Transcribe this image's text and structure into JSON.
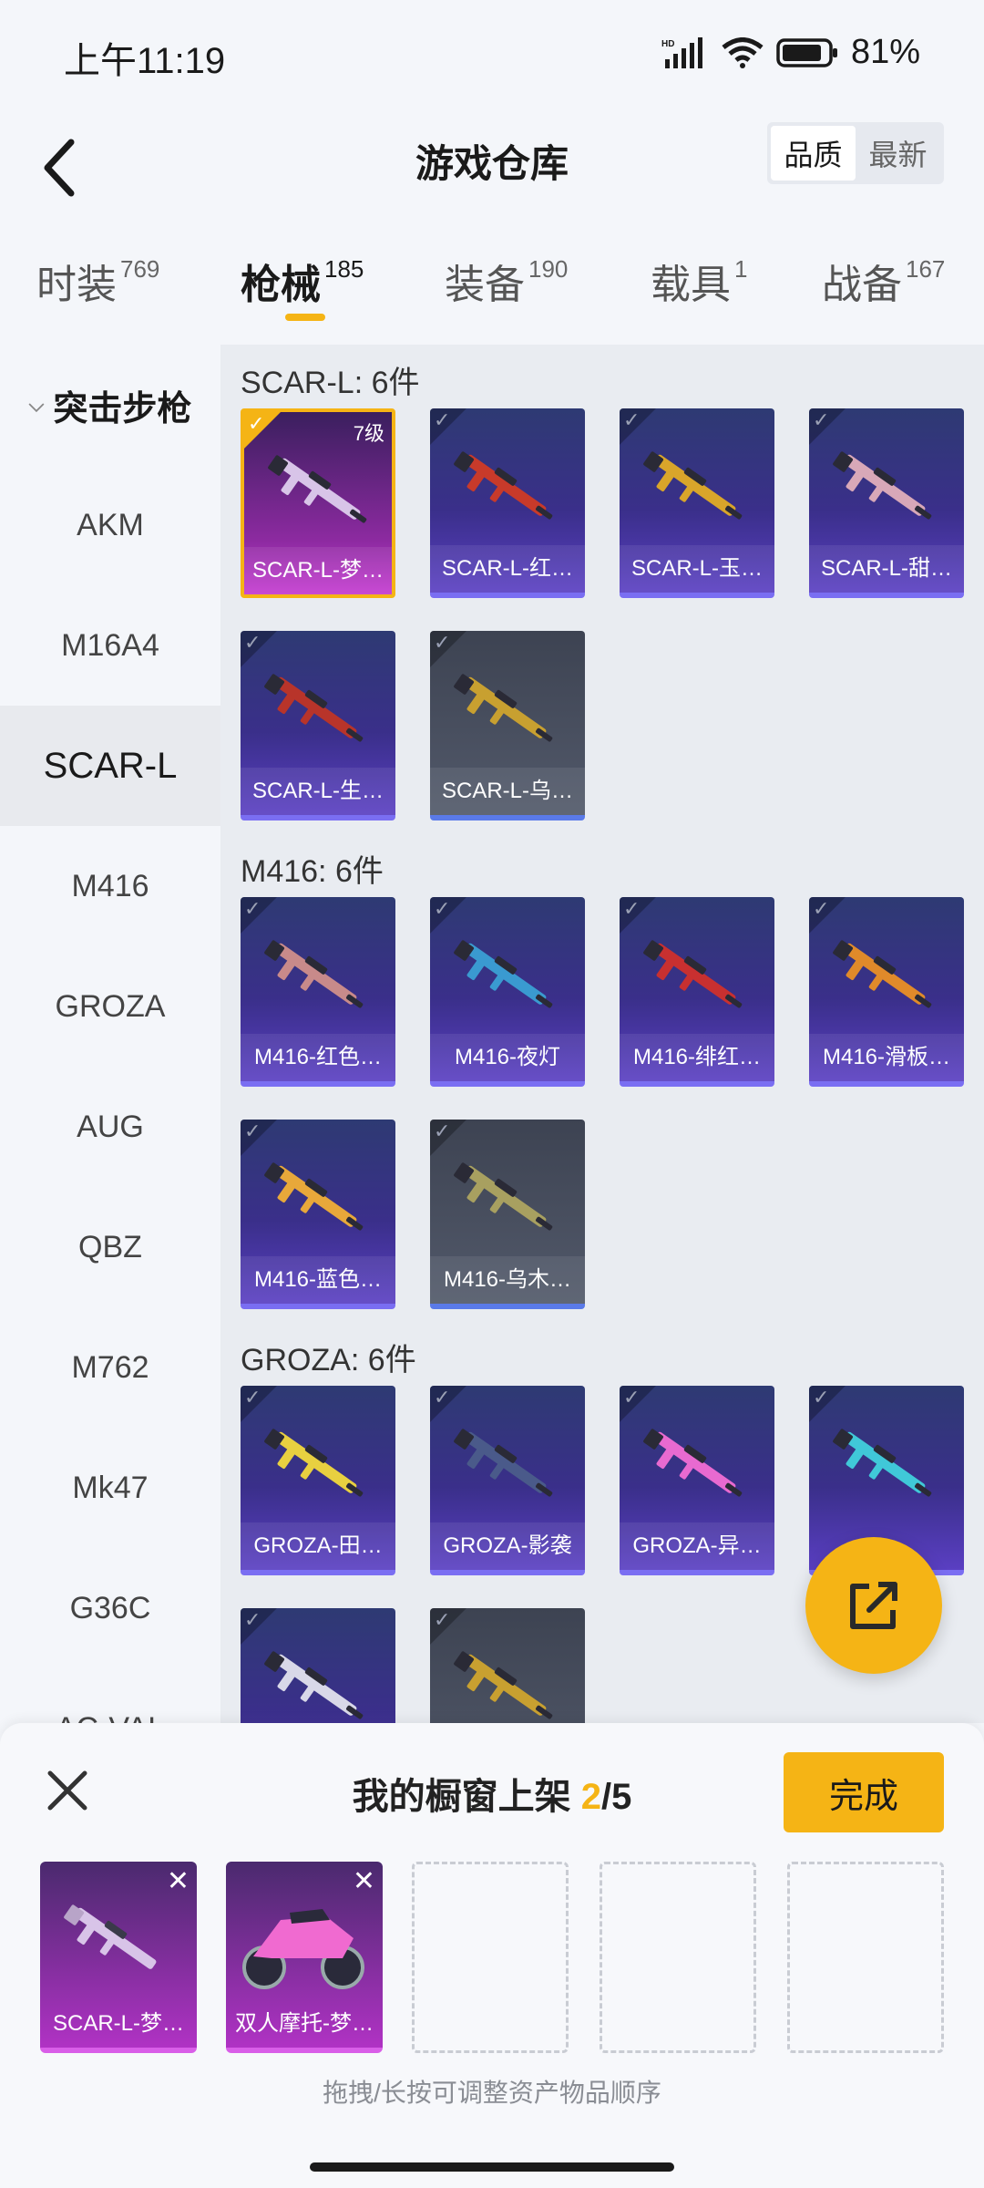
{
  "status": {
    "time": "上午11:19",
    "battery": "81%"
  },
  "header": {
    "title": "游戏仓库",
    "sort_options": [
      "品质",
      "最新"
    ],
    "active_sort": 0
  },
  "tabs": [
    {
      "label": "时装",
      "count": "769"
    },
    {
      "label": "枪械",
      "count": "185"
    },
    {
      "label": "装备",
      "count": "190"
    },
    {
      "label": "载具",
      "count": "1"
    },
    {
      "label": "战备",
      "count": "167"
    }
  ],
  "active_tab": 1,
  "sidebar": {
    "group": "突击步枪",
    "items": [
      "AKM",
      "M16A4",
      "SCAR-L",
      "M416",
      "GROZA",
      "AUG",
      "QBZ",
      "M762",
      "Mk47",
      "G36C",
      "AC-VAL"
    ],
    "active": "SCAR-L"
  },
  "sections": [
    {
      "title": "SCAR-L: 6件",
      "items": [
        {
          "name": "SCAR-L-梦…",
          "style": "pink",
          "level": "7级",
          "gun_color": "#d8c4e8"
        },
        {
          "name": "SCAR-L-红…",
          "style": "purple",
          "gun_color": "#c83a2a"
        },
        {
          "name": "SCAR-L-玉…",
          "style": "purple",
          "gun_color": "#d9a52a"
        },
        {
          "name": "SCAR-L-甜…",
          "style": "purple",
          "gun_color": "#d8a8b8"
        },
        {
          "name": "SCAR-L-生…",
          "style": "purple",
          "gun_color": "#b8342a"
        },
        {
          "name": "SCAR-L-乌…",
          "style": "gray",
          "gun_color": "#c8a030"
        }
      ]
    },
    {
      "title": "M416: 6件",
      "items": [
        {
          "name": "M416-红色…",
          "style": "purple",
          "gun_color": "#c88a8a"
        },
        {
          "name": "M416-夜灯",
          "style": "purple",
          "gun_color": "#3a9ad0"
        },
        {
          "name": "M416-绯红…",
          "style": "purple",
          "gun_color": "#c83030"
        },
        {
          "name": "M416-滑板…",
          "style": "purple",
          "gun_color": "#e08a2a"
        },
        {
          "name": "M416-蓝色…",
          "style": "purple",
          "gun_color": "#e8a83a"
        },
        {
          "name": "M416-乌木…",
          "style": "gray",
          "gun_color": "#a8a060"
        }
      ]
    },
    {
      "title": "GROZA: 6件",
      "items": [
        {
          "name": "GROZA-田…",
          "style": "purple",
          "gun_color": "#e8d040"
        },
        {
          "name": "GROZA-影袭",
          "style": "purple",
          "gun_color": "#4a5a8a"
        },
        {
          "name": "GROZA-异…",
          "style": "purple",
          "gun_color": "#e86ad0"
        },
        {
          "name": "",
          "style": "purple",
          "gun_color": "#40c8d8"
        },
        {
          "name": "",
          "style": "purple",
          "gun_color": "#d8d8e8"
        },
        {
          "name": "",
          "style": "gray",
          "gun_color": "#c8a030"
        }
      ]
    }
  ],
  "sheet": {
    "title_prefix": "我的橱窗上架 ",
    "count": "2",
    "total": "/5",
    "done_label": "完成",
    "slots": [
      {
        "name": "SCAR-L-梦…",
        "filled": true
      },
      {
        "name": "双人摩托-梦…",
        "filled": true
      },
      {
        "filled": false
      },
      {
        "filled": false
      },
      {
        "filled": false
      }
    ],
    "hint": "拖拽/长按可调整资产物品顺序"
  },
  "colors": {
    "accent": "#f5b415"
  }
}
